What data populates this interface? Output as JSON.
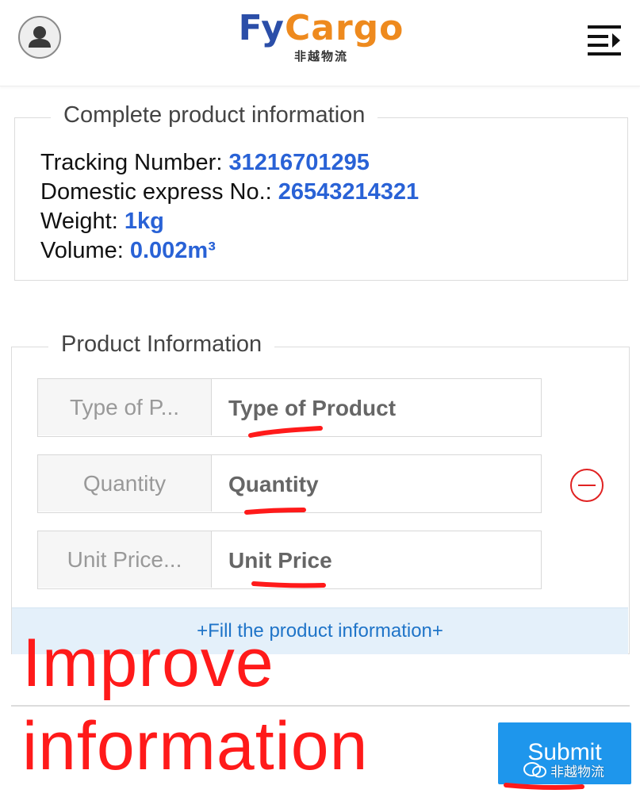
{
  "header": {
    "logo": {
      "part1": "Fy",
      "part2": "Cargo",
      "subtitle": "非越物流"
    },
    "avatar_icon": "user-avatar-icon",
    "menu_icon": "menu-collapse-icon"
  },
  "complete_info": {
    "legend": "Complete product information",
    "tracking_label": "Tracking Number: ",
    "tracking_value": "31216701295",
    "express_label": "Domestic express No.: ",
    "express_value": "26543214321",
    "weight_label": "Weight: ",
    "weight_value": "1kg",
    "volume_label": "Volume: ",
    "volume_value": "0.002m³"
  },
  "product_info": {
    "legend": "Product Information",
    "fields": [
      {
        "label": "Type of P...",
        "value": "Type of Product"
      },
      {
        "label": "Quantity",
        "value": "Quantity"
      },
      {
        "label": "Unit Price...",
        "value": "Unit Price"
      }
    ],
    "add_link": "+Fill the product information+"
  },
  "submit_label": "Submit",
  "annotation": {
    "line1": "Improve",
    "line2": "information",
    "color": "#ff1a1a"
  },
  "watermark": "非越物流",
  "colors": {
    "accent_blue": "#2962d6",
    "button_blue": "#1e96ec",
    "logo_blue": "#2b4ea8",
    "logo_orange": "#ee8a1e",
    "remove_red": "#e02222"
  }
}
